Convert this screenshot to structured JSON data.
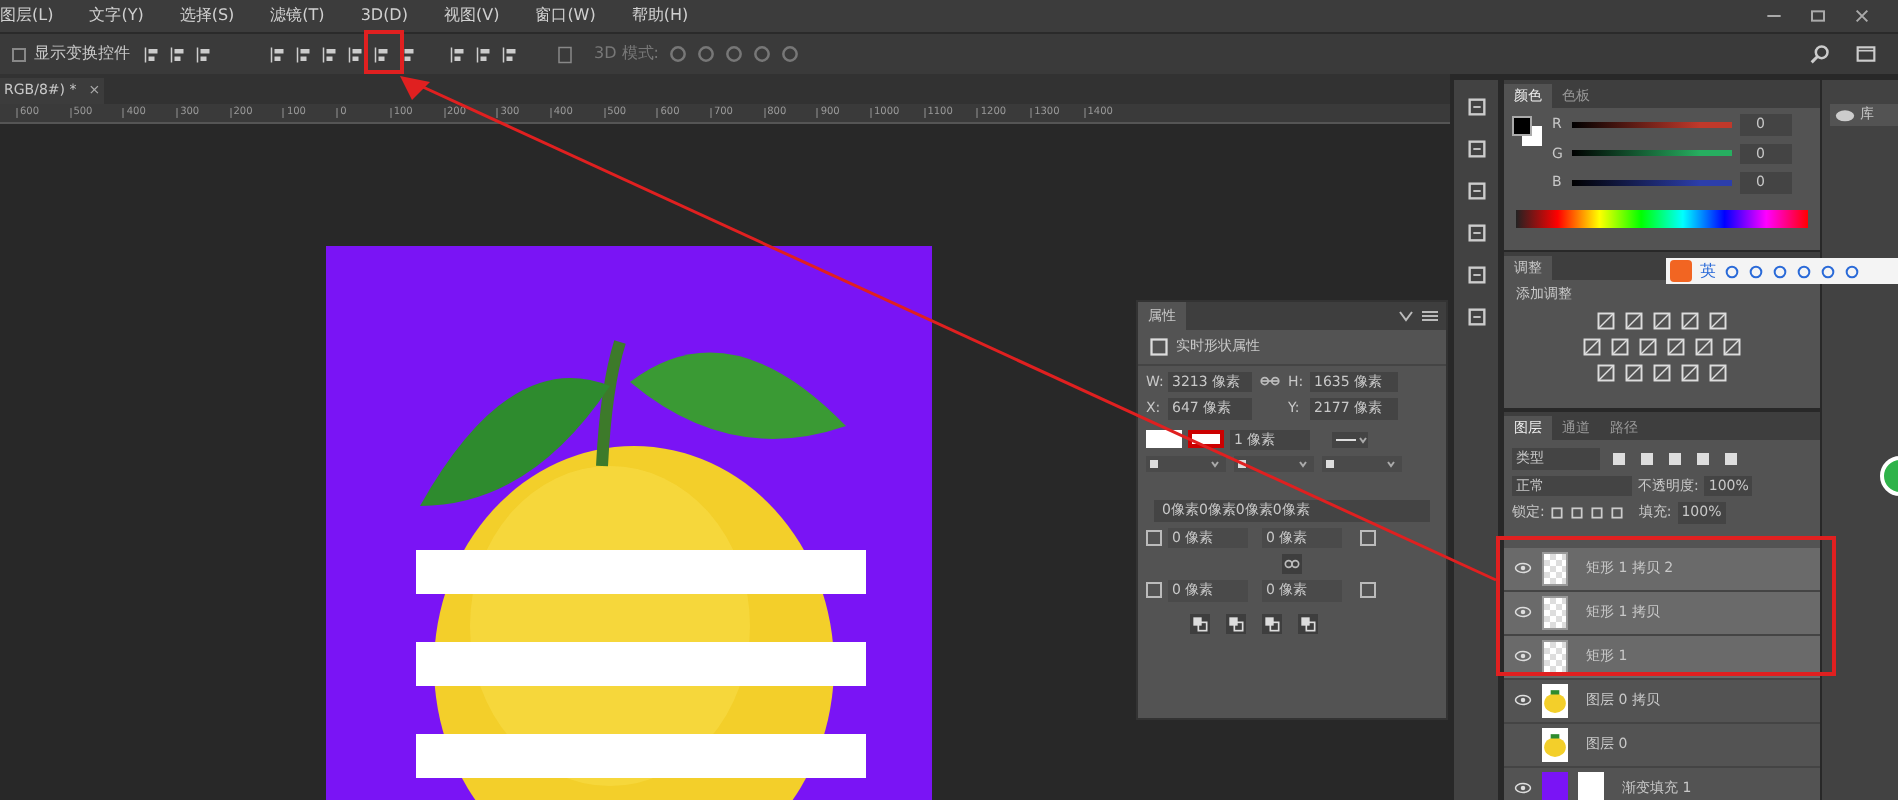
{
  "menu": [
    "图层(L)",
    "文字(Y)",
    "选择(S)",
    "滤镜(T)",
    "3D(D)",
    "视图(V)",
    "窗口(W)",
    "帮助(H)"
  ],
  "options_bar": {
    "show_transform": {
      "label": "显示变换控件",
      "checked": false
    },
    "mode_label": "3D 模式:"
  },
  "document_tab": {
    "title": "RGB/8#) *",
    "close": "×"
  },
  "ruler": [
    "600",
    "500",
    "400",
    "300",
    "200",
    "100",
    "0",
    "100",
    "200",
    "300",
    "400",
    "500",
    "600",
    "700",
    "800",
    "900",
    "1000",
    "1100",
    "1200",
    "1300",
    "1400"
  ],
  "properties": {
    "title": "属性",
    "subtitle": "实时形状属性",
    "w_label": "W:",
    "w": "3213 像素",
    "h_label": "H:",
    "h": "1635 像素",
    "x_label": "X:",
    "x": "647 像素",
    "y_label": "Y:",
    "y": "2177 像素",
    "stroke": "1 像素",
    "corners_all": "0像素0像素0像素0像素",
    "corners": [
      "0 像素",
      "0 像素",
      "0 像素",
      "0 像素"
    ]
  },
  "color_panel": {
    "tabs": [
      {
        "label": "颜色",
        "selected": true
      },
      {
        "label": "色板",
        "selected": false
      }
    ],
    "channels": [
      {
        "name": "R",
        "value": "0",
        "color": "#c0392b"
      },
      {
        "name": "G",
        "value": "0",
        "color": "#27ae60"
      },
      {
        "name": "B",
        "value": "0",
        "color": "#2c3eaa"
      }
    ]
  },
  "adjustments": {
    "title": "调整",
    "subtitle": "添加调整"
  },
  "library": {
    "label": "库"
  },
  "ime": {
    "label": "英"
  },
  "layers_panel": {
    "tabs": [
      {
        "label": "图层",
        "selected": true
      },
      {
        "label": "通道",
        "selected": false
      },
      {
        "label": "路径",
        "selected": false
      }
    ],
    "filter": "类型",
    "blend": "正常",
    "opacity_label": "不透明度:",
    "opacity": "100%",
    "lock_label": "锁定:",
    "fill_label": "填充:",
    "fill": "100%",
    "layers": [
      {
        "name": "矩形 1 拷贝 2",
        "kind": "shape",
        "visible": true,
        "selected": true
      },
      {
        "name": "矩形 1 拷贝",
        "kind": "shape",
        "visible": true,
        "selected": true
      },
      {
        "name": "矩形 1",
        "kind": "shape",
        "visible": true,
        "selected": true
      },
      {
        "name": "图层 0 拷贝",
        "kind": "image",
        "visible": true,
        "selected": false
      },
      {
        "name": "图层 0",
        "kind": "image",
        "visible": false,
        "selected": false
      },
      {
        "name": "渐变填充 1",
        "kind": "gradient",
        "visible": true,
        "selected": false
      }
    ]
  }
}
